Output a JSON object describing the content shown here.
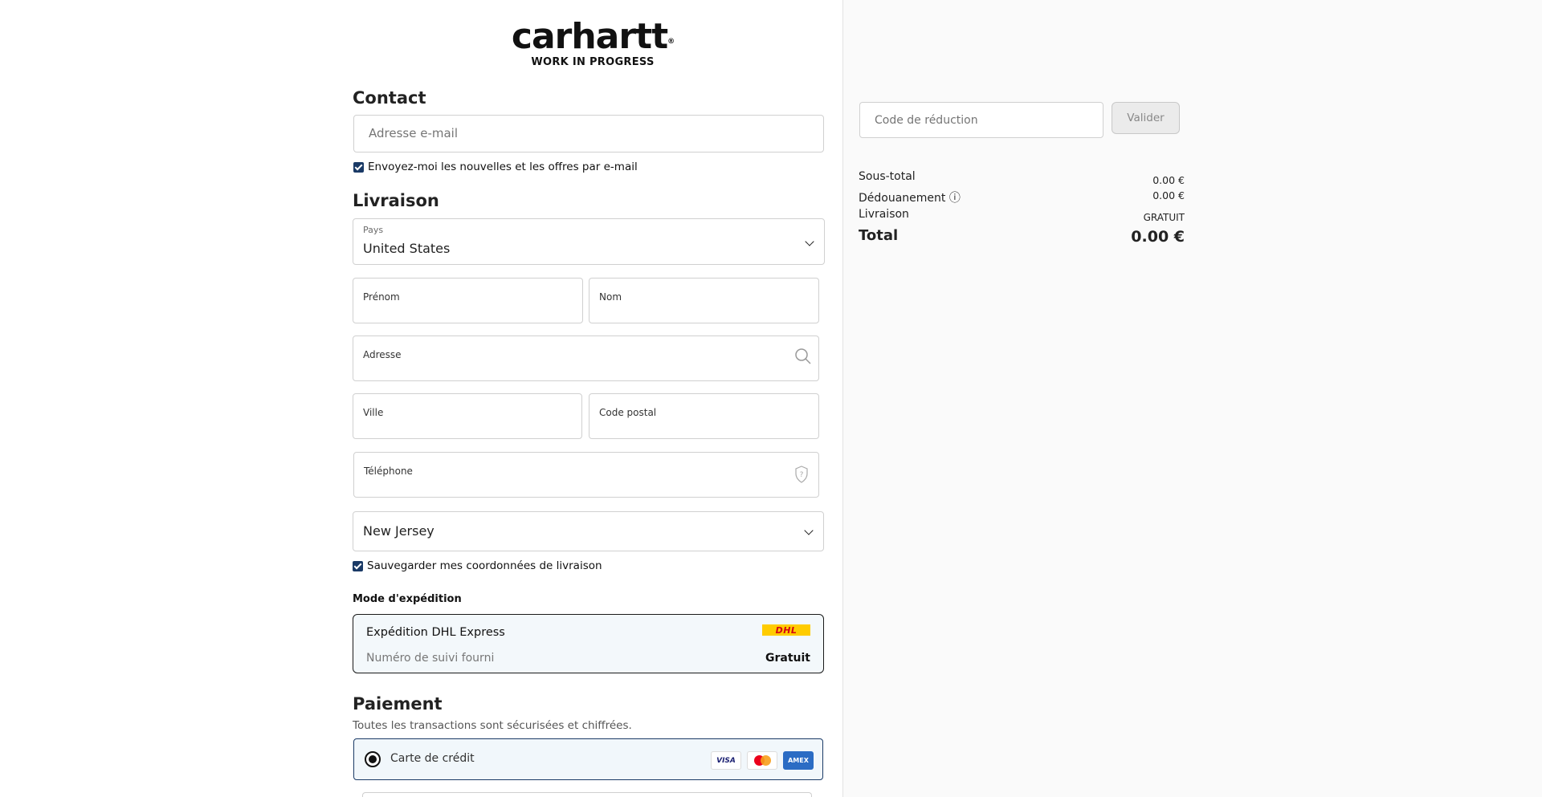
{
  "brand": {
    "name": "carhartt",
    "tagline": "WORK IN PROGRESS"
  },
  "contact": {
    "heading": "Contact",
    "email_placeholder": "Adresse e-mail",
    "newsletter_label": "Envoyez-moi les nouvelles et les offres par e-mail",
    "newsletter_checked": true
  },
  "delivery": {
    "heading": "Livraison",
    "country_label": "Pays",
    "country_value": "United States",
    "first_name": "Prénom",
    "last_name": "Nom",
    "address": "Adresse",
    "city": "Ville",
    "postal_code": "Code postal",
    "phone": "Téléphone",
    "state_value": "New Jersey",
    "save_label": "Sauvegarder mes coordonnées de livraison",
    "save_checked": true
  },
  "shipping": {
    "heading": "Mode d'expédition",
    "option_title": "Expédition DHL Express",
    "option_sub": "Numéro de suivi fourni",
    "option_price": "Gratuit",
    "carrier_logo": "DHL"
  },
  "payment": {
    "heading": "Paiement",
    "subtitle": "Toutes les transactions sont sécurisées et chiffrées.",
    "method_label": "Carte de crédit",
    "cards": [
      "VISA",
      "mastercard",
      "AMEX"
    ]
  },
  "summary": {
    "discount_placeholder": "Code de réduction",
    "apply_label": "Valider",
    "subtotal_label": "Sous-total",
    "subtotal_value": "0.00 €",
    "duties_label": "Dédouanement ⓘ",
    "duties_value": "0.00 €",
    "shipping_label": "Livraison",
    "shipping_value": "GRATUIT",
    "total_label": "Total",
    "total_value": "0.00 €"
  },
  "colors": {
    "accent": "#1a3a66",
    "selected_bg": "#f3f8fb",
    "summary_bg": "#fafafa"
  },
  "icons": {
    "search": "search-icon",
    "help": "help-shield-icon",
    "chevron": "chevron-down-icon"
  }
}
